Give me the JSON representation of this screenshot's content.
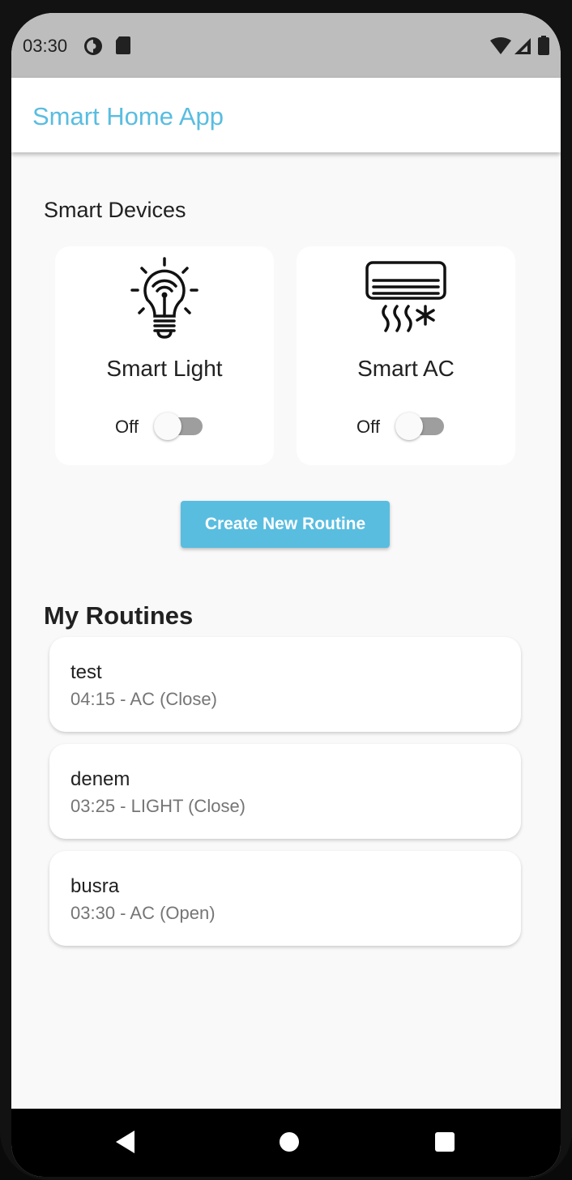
{
  "status_bar": {
    "time": "03:30",
    "icons": [
      "data-saver-icon",
      "sd-card-icon",
      "wifi-icon",
      "signal-icon",
      "battery-icon"
    ]
  },
  "app_bar": {
    "title": "Smart Home App"
  },
  "devices_section": {
    "title": "Smart Devices",
    "devices": [
      {
        "name": "Smart Light",
        "state_label": "Off",
        "on": false,
        "icon": "smart-bulb-icon"
      },
      {
        "name": "Smart AC",
        "state_label": "Off",
        "on": false,
        "icon": "air-conditioner-icon"
      }
    ]
  },
  "create_routine_label": "Create New Routine",
  "routines_section": {
    "title": "My Routines",
    "items": [
      {
        "name": "test",
        "detail": "04:15 - AC (Close)"
      },
      {
        "name": "denem",
        "detail": "03:25 - LIGHT (Close)"
      },
      {
        "name": "busra",
        "detail": "03:30 - AC (Open)"
      }
    ]
  },
  "nav_bar": {
    "icons": [
      "back-icon",
      "home-icon",
      "recents-icon"
    ]
  },
  "colors": {
    "accent": "#59bde0",
    "status_bar": "#bdbdbd",
    "background": "#f9f9f9"
  }
}
